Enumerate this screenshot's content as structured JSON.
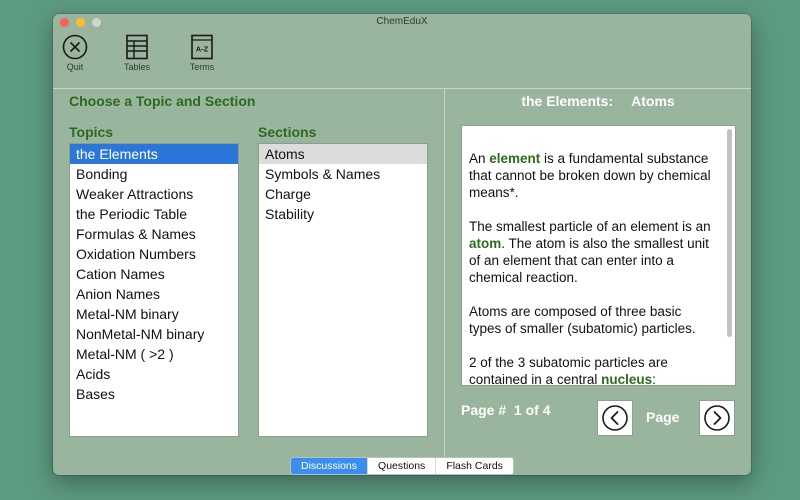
{
  "window": {
    "title": "ChemEduX"
  },
  "toolbar": {
    "quit_label": "Quit",
    "tables_label": "Tables",
    "terms_label": "Terms",
    "terms_icon_text": "A-Z"
  },
  "left": {
    "heading": "Choose a Topic and Section",
    "topics_heading": "Topics",
    "sections_heading": "Sections",
    "topics": [
      "the Elements",
      "Bonding",
      "Weaker Attractions",
      "the Periodic Table",
      "Formulas & Names",
      "Oxidation Numbers",
      "Cation Names",
      "Anion Names",
      "Metal-NM binary",
      "NonMetal-NM binary",
      "Metal-NM ( >2 )",
      "Acids",
      "Bases"
    ],
    "selected_topic": "the Elements",
    "sections": [
      "Atoms",
      "Symbols & Names",
      "Charge",
      "Stability"
    ],
    "selected_section": "Atoms"
  },
  "right": {
    "topic_title": "the Elements:",
    "section_title": "Atoms",
    "paragraphs": [
      {
        "pre": "An ",
        "bold": "element",
        "post": " is a fundamental substance that cannot be broken down by chemical means*."
      },
      {
        "pre": "The smallest particle of an element is an ",
        "bold": "atom",
        "post": ".  The atom is also the smallest unit of an element that can enter into a chemical reaction."
      },
      {
        "pre": "Atoms are composed of three basic types of smaller (subatomic) particles.",
        "bold": "",
        "post": ""
      },
      {
        "pre": "2 of the 3 subatomic particles are contained in a central ",
        "bold": "nucleus",
        "post": ":"
      }
    ],
    "page_prefix": "Page #",
    "page_value": "1 of 4",
    "page_label": "Page"
  },
  "tabs": [
    "Discussions",
    "Questions",
    "Flash Cards"
  ],
  "active_tab": "Discussions",
  "colors": {
    "desktop": "#5d9a82",
    "window": "#9ab59d",
    "heading_green": "#2d6a1f",
    "selection_blue": "#2b76d9",
    "tab_active": "#3a8ef0"
  }
}
